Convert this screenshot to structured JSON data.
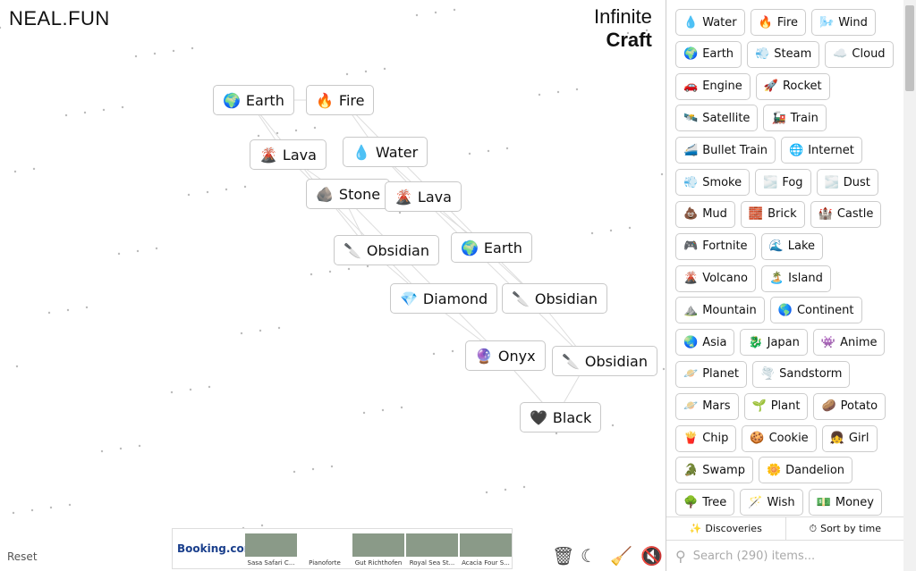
{
  "logo": "NEAL.FUN",
  "title": {
    "line1": "Infinite",
    "line2": "Craft"
  },
  "canvas_elements": [
    {
      "emoji": "🌍",
      "label": "Earth"
    },
    {
      "emoji": "🔥",
      "label": "Fire"
    },
    {
      "emoji": "🌋",
      "label": "Lava"
    },
    {
      "emoji": "💧",
      "label": "Water"
    },
    {
      "emoji": "🪨",
      "label": "Stone"
    },
    {
      "emoji": "🌋",
      "label": "Lava"
    },
    {
      "emoji": "🔪",
      "label": "Obsidian"
    },
    {
      "emoji": "🌍",
      "label": "Earth"
    },
    {
      "emoji": "💎",
      "label": "Diamond"
    },
    {
      "emoji": "🔪",
      "label": "Obsidian"
    },
    {
      "emoji": "🔮",
      "label": "Onyx"
    },
    {
      "emoji": "🔪",
      "label": "Obsidian"
    },
    {
      "emoji": "🖤",
      "label": "Black"
    }
  ],
  "reset": "Reset",
  "ad": {
    "brand": "Booking.com",
    "hotels": [
      "Sasa Safari C...",
      "Pianoforte",
      "Gut Richthofen",
      "Royal Sea St...",
      "Acacia Four S..."
    ]
  },
  "toolbar": {
    "delete": "trash-icon",
    "theme": "moon-icon",
    "clear": "broom-icon",
    "sound": "mute-icon"
  },
  "sidebar": {
    "items": [
      {
        "emoji": "💧",
        "label": "Water"
      },
      {
        "emoji": "🔥",
        "label": "Fire"
      },
      {
        "emoji": "🌬️",
        "label": "Wind"
      },
      {
        "emoji": "🌍",
        "label": "Earth"
      },
      {
        "emoji": "💨",
        "label": "Steam"
      },
      {
        "emoji": "☁️",
        "label": "Cloud"
      },
      {
        "emoji": "🚗",
        "label": "Engine"
      },
      {
        "emoji": "🚀",
        "label": "Rocket"
      },
      {
        "emoji": "🛰️",
        "label": "Satellite"
      },
      {
        "emoji": "🚂",
        "label": "Train"
      },
      {
        "emoji": "🚄",
        "label": "Bullet Train"
      },
      {
        "emoji": "🌐",
        "label": "Internet"
      },
      {
        "emoji": "💨",
        "label": "Smoke"
      },
      {
        "emoji": "🌫️",
        "label": "Fog"
      },
      {
        "emoji": "🌫️",
        "label": "Dust"
      },
      {
        "emoji": "💩",
        "label": "Mud"
      },
      {
        "emoji": "🧱",
        "label": "Brick"
      },
      {
        "emoji": "🏰",
        "label": "Castle"
      },
      {
        "emoji": "🎮",
        "label": "Fortnite"
      },
      {
        "emoji": "🌊",
        "label": "Lake"
      },
      {
        "emoji": "🌋",
        "label": "Volcano"
      },
      {
        "emoji": "🏝️",
        "label": "Island"
      },
      {
        "emoji": "⛰️",
        "label": "Mountain"
      },
      {
        "emoji": "🌎",
        "label": "Continent"
      },
      {
        "emoji": "🌏",
        "label": "Asia"
      },
      {
        "emoji": "🐉",
        "label": "Japan"
      },
      {
        "emoji": "👾",
        "label": "Anime"
      },
      {
        "emoji": "🪐",
        "label": "Planet"
      },
      {
        "emoji": "🌪️",
        "label": "Sandstorm"
      },
      {
        "emoji": "🪐",
        "label": "Mars"
      },
      {
        "emoji": "🌱",
        "label": "Plant"
      },
      {
        "emoji": "🥔",
        "label": "Potato"
      },
      {
        "emoji": "🍟",
        "label": "Chip"
      },
      {
        "emoji": "🍪",
        "label": "Cookie"
      },
      {
        "emoji": "👧",
        "label": "Girl"
      },
      {
        "emoji": "🐊",
        "label": "Swamp"
      },
      {
        "emoji": "🌼",
        "label": "Dandelion"
      },
      {
        "emoji": "🌳",
        "label": "Tree"
      },
      {
        "emoji": "🪄",
        "label": "Wish"
      },
      {
        "emoji": "💵",
        "label": "Money"
      }
    ],
    "tabs": {
      "discoveries": "Discoveries",
      "sort": "Sort by time"
    },
    "search_placeholder": "Search (290) items..."
  }
}
